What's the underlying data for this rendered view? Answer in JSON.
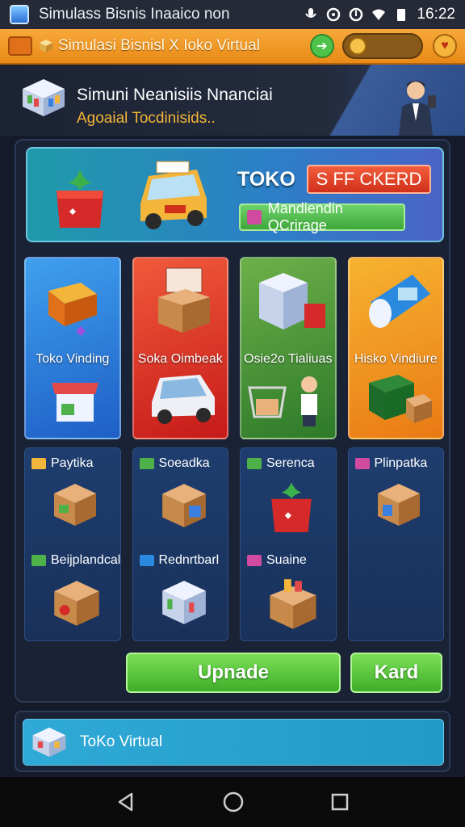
{
  "status_bar": {
    "title": "Simulass Bisnis Inaaico non",
    "time": "16:22"
  },
  "toolbar": {
    "title": "Simulasi Bisnisl X Ioko Virtual"
  },
  "hero": {
    "title": "Simuni Neanisiis Nnanciai",
    "subtitle": "Agoaial Tocdinisids.."
  },
  "banner": {
    "toko": "TOKO",
    "button": "S FF CKERD",
    "pill": "Mandiendin QCrirage"
  },
  "categories": [
    {
      "label": "Toko Vinding"
    },
    {
      "label": "Soka Oimbeak"
    },
    {
      "label": "Osie2o Tialiuas"
    },
    {
      "label": "Hisko Vindiure"
    }
  ],
  "items": {
    "col1_top": "Paytika",
    "col1_bottom": "Beijplandcal",
    "col2_top": "Soeadka",
    "col2_bottom": "Rednrtbarl",
    "col3_top": "Serenca",
    "col3_bottom": "Suaine",
    "col4_top": "Plinpatka"
  },
  "actions": {
    "update": "Upnade",
    "kard": "Kard"
  },
  "footer": {
    "label": "ToKo Virtual"
  },
  "colors": {
    "accent_orange": "#e98a16",
    "green": "#4fc24a",
    "panel": "#1a2236"
  }
}
